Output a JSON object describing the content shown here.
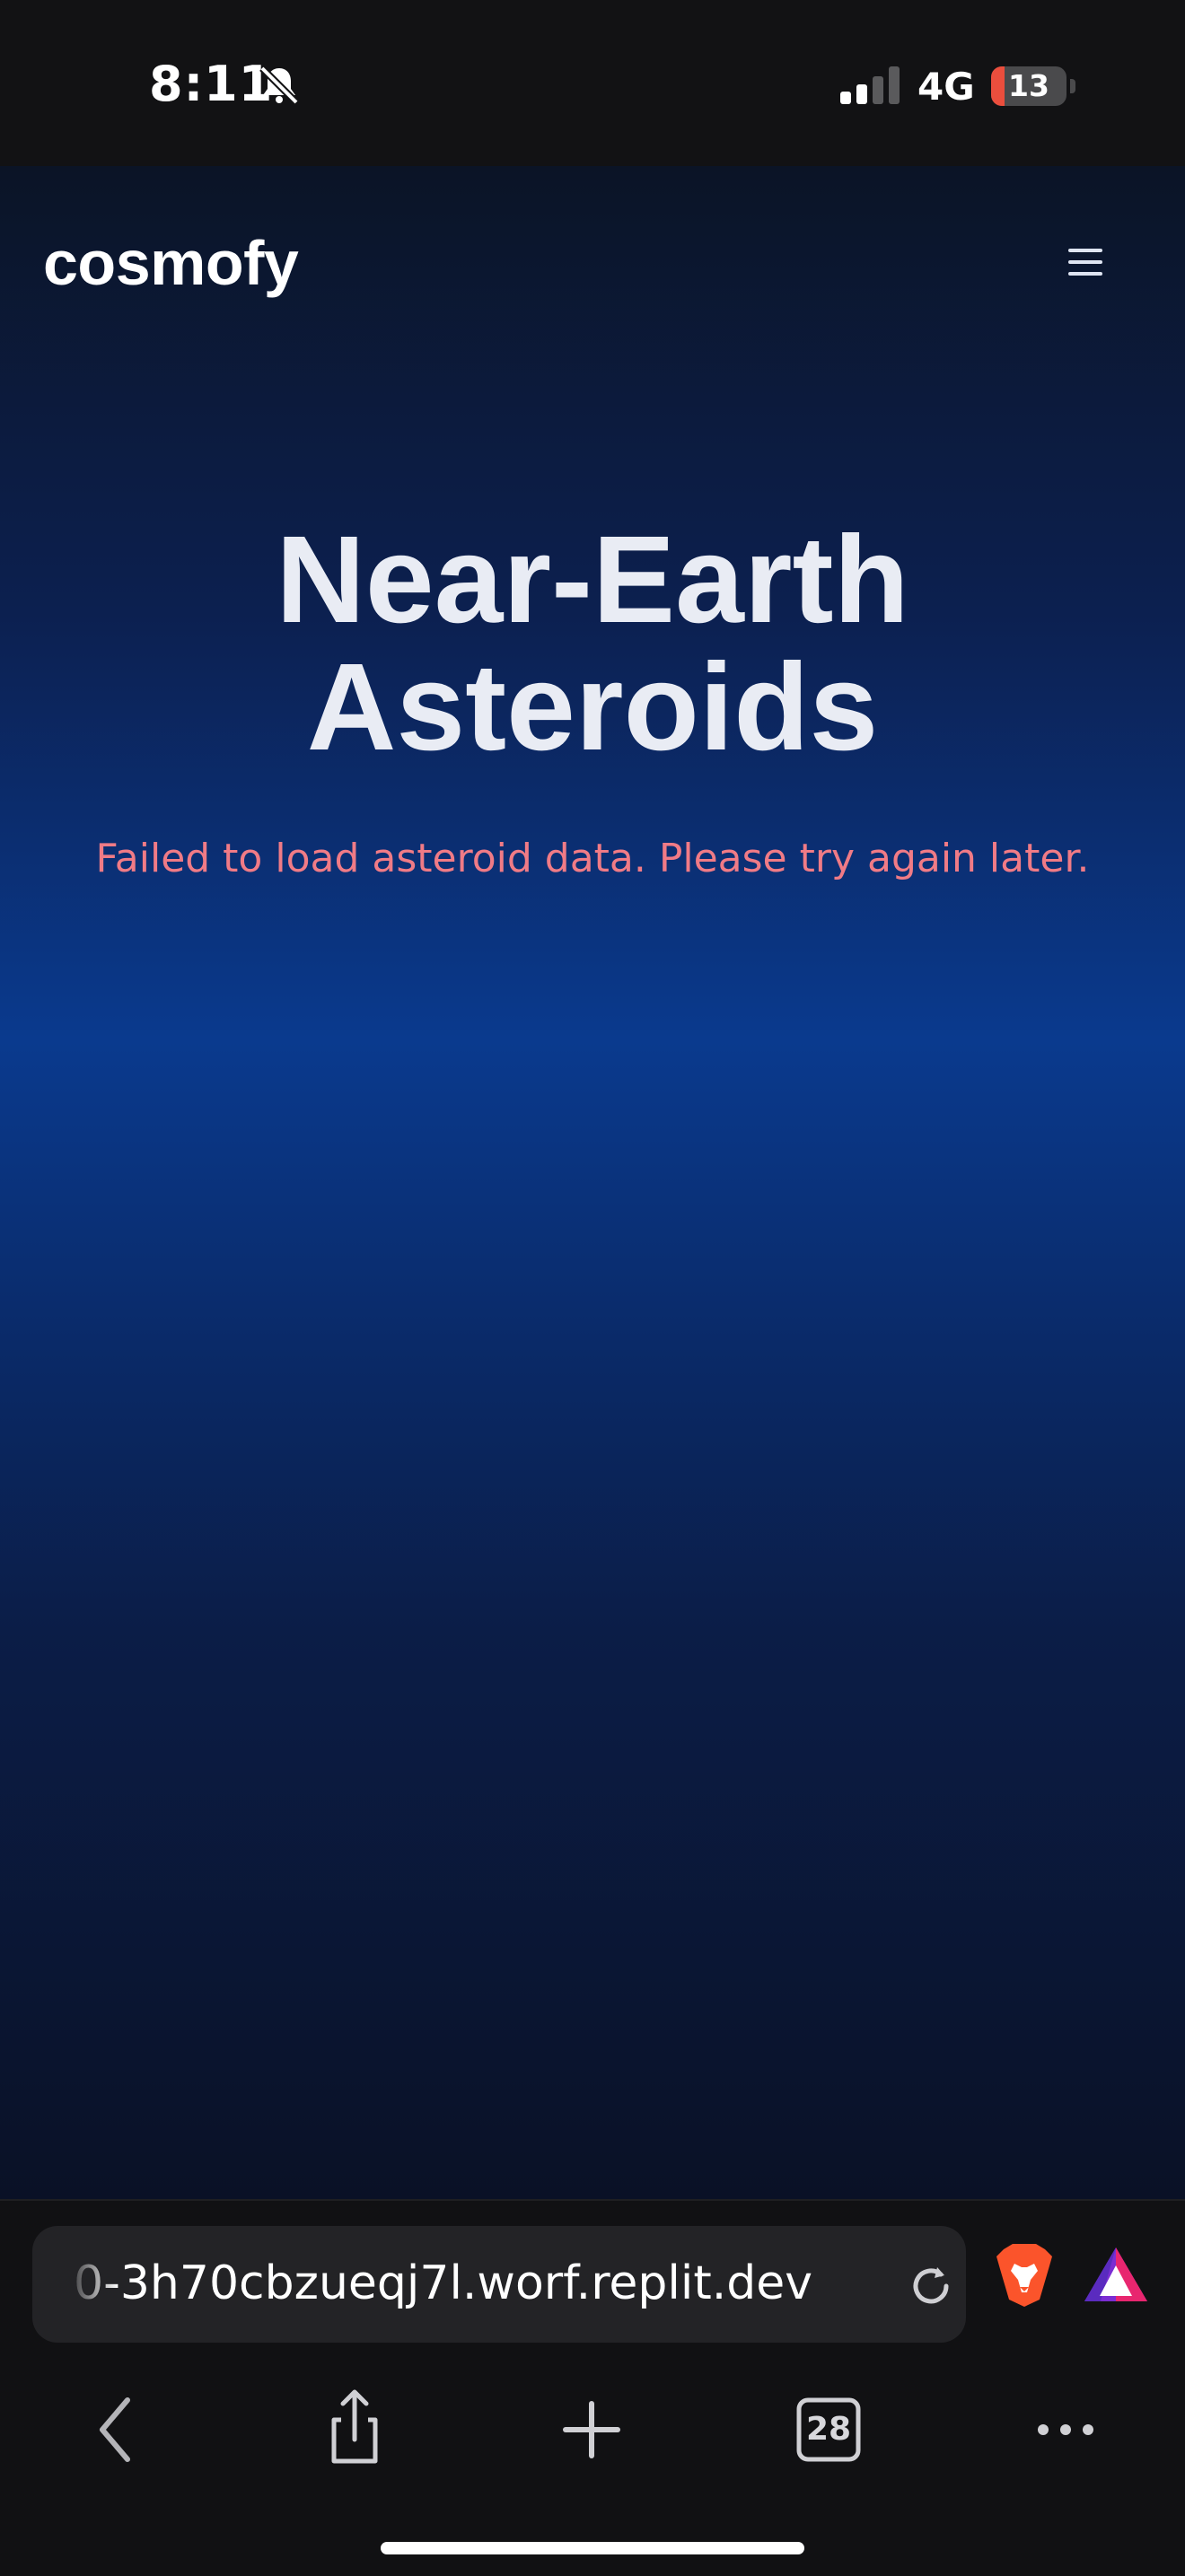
{
  "status_bar": {
    "time": "8:11",
    "network": "4G",
    "battery_level": "13",
    "battery_percent": 13,
    "icons": [
      "bell-slash-icon",
      "signal-icon",
      "battery-icon"
    ]
  },
  "site": {
    "brand": "cosmofy",
    "menu_icon": "hamburger-menu-icon",
    "hero_title_line1": "Near-Earth",
    "hero_title_line2": "Asteroids",
    "error_message": "Failed to load asteroid data. Please try again later."
  },
  "browser": {
    "url": "0-3h70cbzueqj7l.worf.replit.dev",
    "icons": [
      "reload-icon",
      "brave-shields-icon",
      "brave-rewards-icon"
    ],
    "toolbar": {
      "back_icon": "back-chevron-icon",
      "share_icon": "share-icon",
      "new_tab_icon": "plus-icon",
      "tabs_count": "28",
      "more_icon": "more-dots-icon"
    }
  },
  "colors": {
    "error": "#f07b86",
    "gradient_mid": "#0a3a8e",
    "brave_orange": "#fb542b"
  }
}
